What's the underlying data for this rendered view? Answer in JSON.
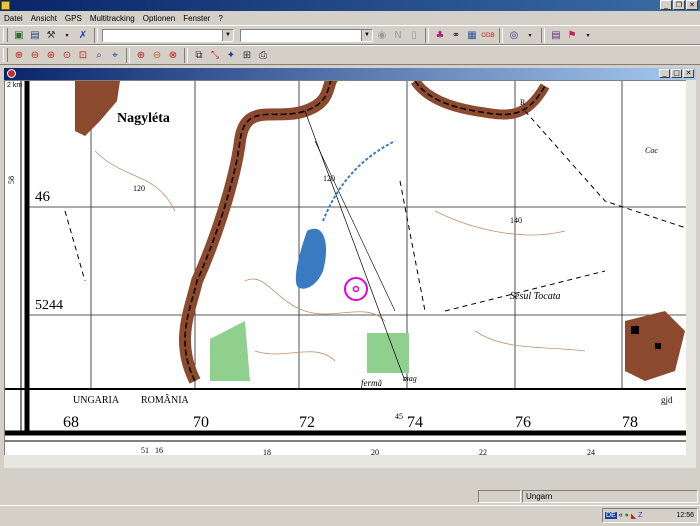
{
  "menu": [
    "Datei",
    "Ansicht",
    "GPS",
    "Multitracking",
    "Optionen",
    "Fenster",
    "?"
  ],
  "map": {
    "scale": "2 km",
    "places": [
      "Nagyléta",
      "Sesul Tocata",
      "fermă"
    ],
    "border_labels": [
      "UNGARIA",
      "ROMÂNIA"
    ],
    "grid_bottom": [
      "68",
      "70",
      "72",
      "74",
      "76",
      "78"
    ],
    "grid_left": [
      "46",
      "5244"
    ],
    "spot_heights": [
      "120",
      "120",
      "140"
    ],
    "minor_bottom": [
      "51",
      "16",
      "18",
      "20",
      "22",
      "24"
    ],
    "misc": [
      "58",
      "45",
      "R",
      "gjd",
      "Coc",
      "mag"
    ]
  },
  "status": {
    "region": "Ungarn"
  },
  "taskbar": {
    "lang": "DE",
    "time": "12:56"
  }
}
